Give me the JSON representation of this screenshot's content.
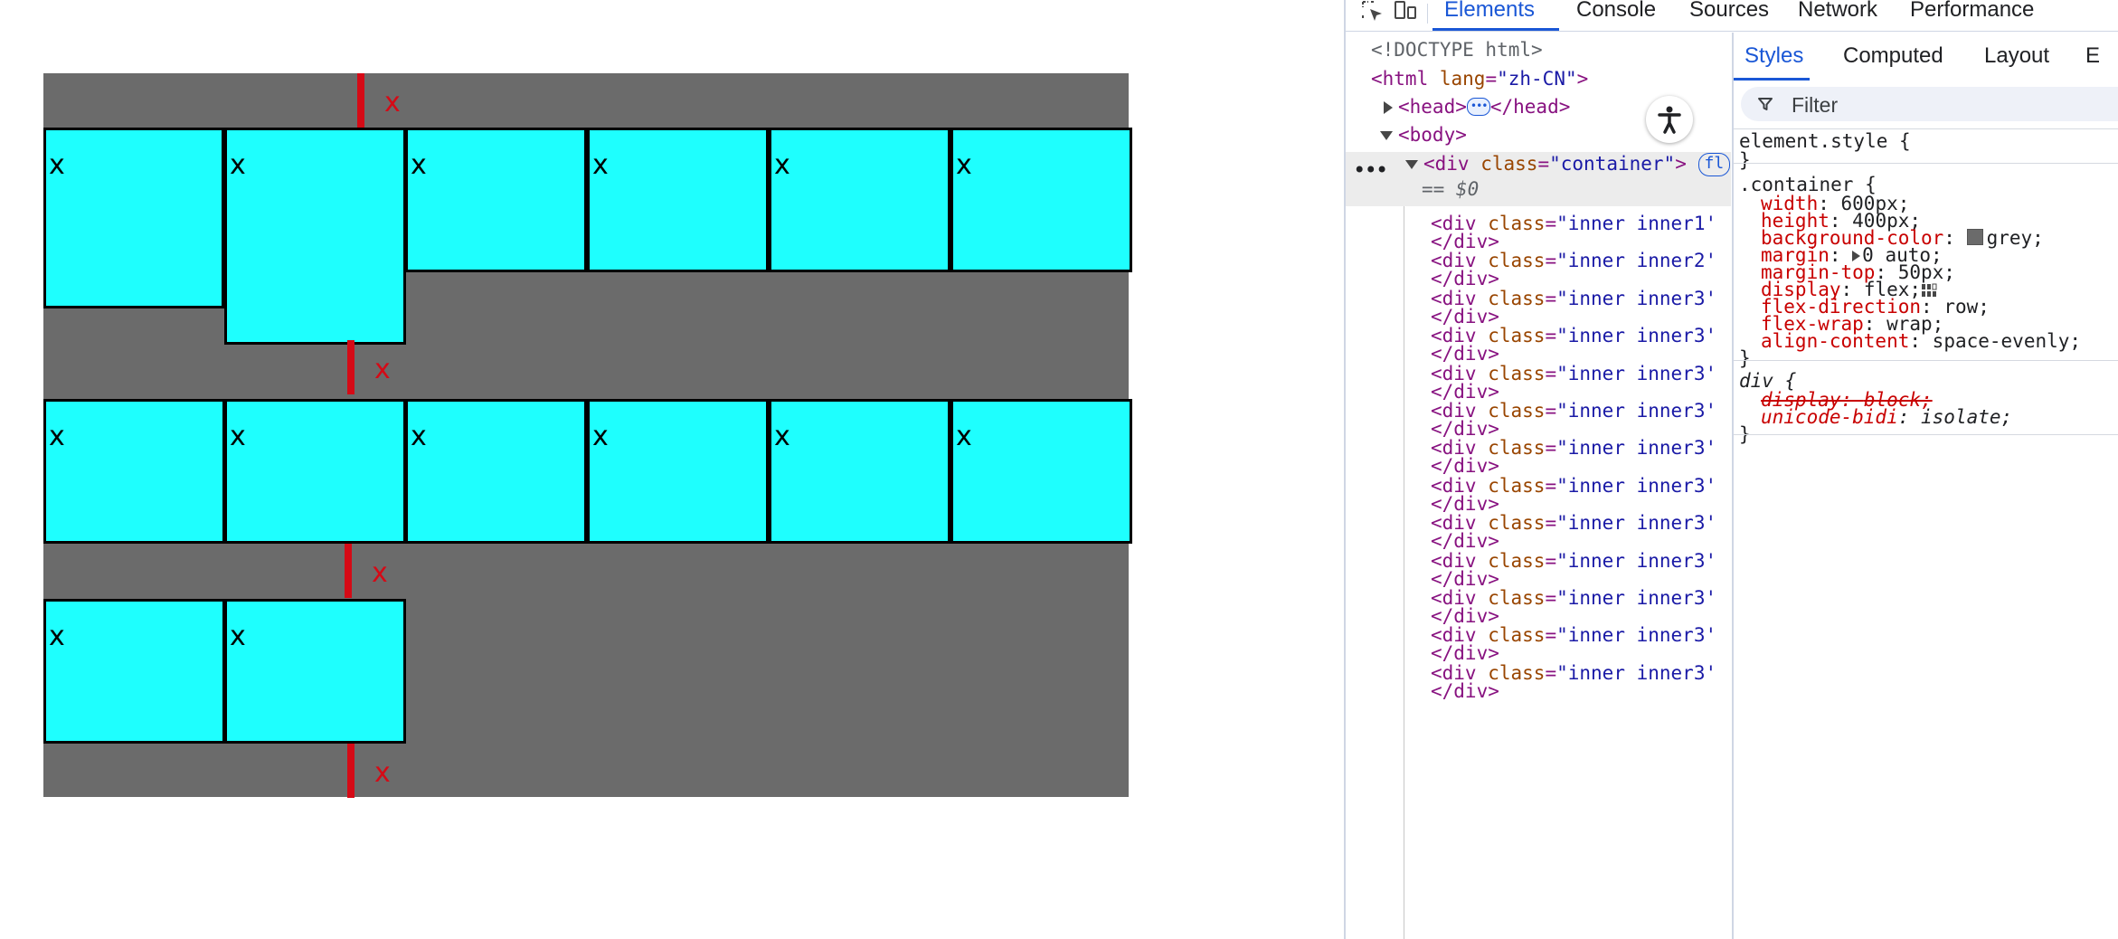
{
  "page": {
    "container_background": "#6b6b6b",
    "inner_background": "#1efffe",
    "gap_marker_color": "#d50a16",
    "item_label": "x",
    "gap_label": "x"
  },
  "devtools": {
    "tabs": [
      {
        "label": "Elements",
        "active": true
      },
      {
        "label": "Console",
        "active": false
      },
      {
        "label": "Sources",
        "active": false
      },
      {
        "label": "Network",
        "active": false
      },
      {
        "label": "Performance",
        "active": false
      }
    ],
    "accent": "#1a57d6",
    "elements": {
      "doctype": "<!DOCTYPE html>",
      "html_tag": "<html",
      "html_attr": "lang",
      "html_val": "\"zh-CN\"",
      "head_open": "<head>",
      "head_close": "</head>",
      "body_tag": "<body>",
      "container_tag": "<div",
      "container_attr": "class",
      "container_val": "\"container\"",
      "flex_badge": "fl",
      "selected_ref": "== $0",
      "inner1": "\"inner inner1'",
      "inner2": "\"inner inner2'",
      "inner3": "\"inner inner3'",
      "div_open": "<div",
      "class_attr": "class",
      "div_close": "</div>"
    },
    "styles": {
      "tabs": [
        {
          "label": "Styles",
          "active": true
        },
        {
          "label": "Computed",
          "active": false
        },
        {
          "label": "Layout",
          "active": false
        },
        {
          "label": "E",
          "active": false
        }
      ],
      "filter_placeholder": "Filter",
      "element_style_selector": "element.style {",
      "close_brace": "}",
      "container_selector": ".container {",
      "rules": {
        "width": {
          "name": "width",
          "value": "600px;"
        },
        "height": {
          "name": "height",
          "value": "400px;"
        },
        "background": {
          "name": "background-color",
          "value": "grey;",
          "swatch": "#6b6b6b"
        },
        "margin": {
          "name": "margin",
          "value": "0 auto;"
        },
        "margin_top": {
          "name": "margin-top",
          "value": "50px;"
        },
        "display": {
          "name": "display",
          "value": "flex;"
        },
        "flex_direction": {
          "name": "flex-direction",
          "value": "row;"
        },
        "flex_wrap": {
          "name": "flex-wrap",
          "value": "wrap;"
        },
        "align_content": {
          "name": "align-content",
          "value": "space-evenly;"
        }
      },
      "div_selector": "div {",
      "ua_rules": {
        "display": {
          "name": "display",
          "value": "block;"
        },
        "unicode_bidi": {
          "name": "unicode-bidi",
          "value": "isolate;"
        }
      }
    }
  }
}
